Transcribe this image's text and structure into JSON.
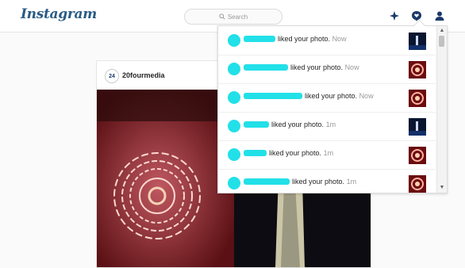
{
  "app": {
    "logo": "Instagram"
  },
  "search": {
    "placeholder": "Search"
  },
  "nav": {
    "explore_icon": "compass-icon",
    "activity_icon": "heart-bubble-icon",
    "profile_icon": "person-icon"
  },
  "post": {
    "username": "20fourmedia",
    "avatar_text": "24"
  },
  "notifications": {
    "items": [
      {
        "action": "liked your photo.",
        "time": "Now"
      },
      {
        "action": "liked your photo.",
        "time": "Now"
      },
      {
        "action": "liked your photo.",
        "time": "Now"
      },
      {
        "action": "liked your photo.",
        "time": "1m"
      },
      {
        "action": "liked your photo.",
        "time": "1m"
      },
      {
        "action": "liked your photo.",
        "time": "1m"
      }
    ]
  },
  "colors": {
    "brand": "#2a5b85",
    "redaction": "#22e0e8"
  }
}
